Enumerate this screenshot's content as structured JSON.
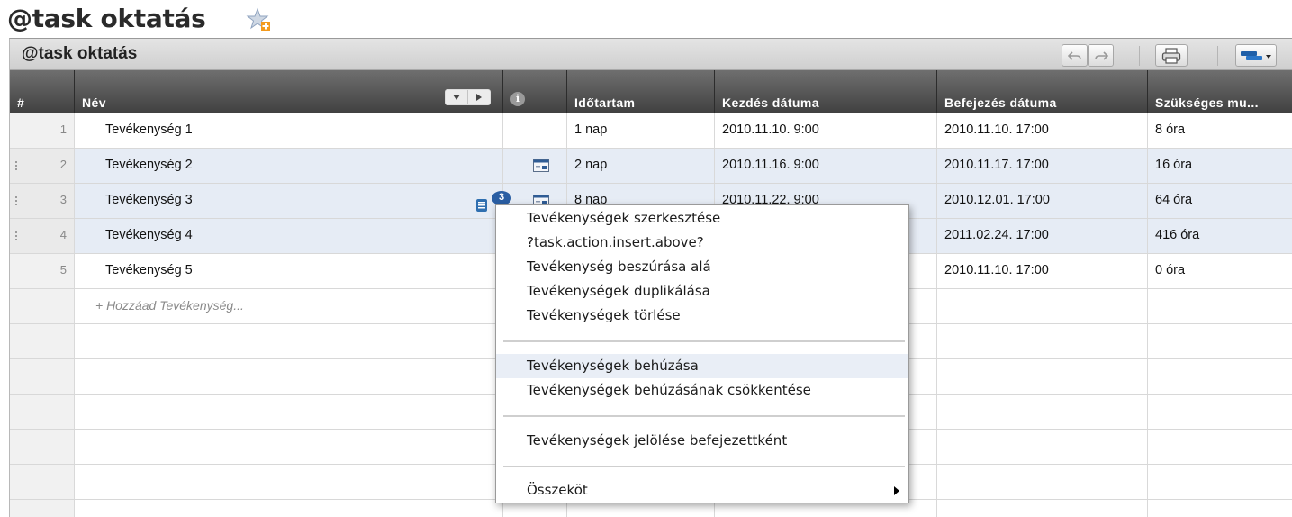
{
  "page": {
    "title": "@task oktatás",
    "favorite_icon": "star-add-icon"
  },
  "panel": {
    "title": "@task oktatás",
    "toolbar": {
      "undo_icon": "undo-icon",
      "redo_icon": "redo-icon",
      "print_icon": "print-icon",
      "gantt_icon": "gantt-view-icon"
    }
  },
  "columns": {
    "num": "#",
    "name": "Név",
    "info": "i",
    "duration": "Időtartam",
    "start": "Kezdés dátuma",
    "end": "Befejezés dátuma",
    "work": "Szükséges mu..."
  },
  "rows": [
    {
      "num": "1",
      "name": "Tevékenység 1",
      "duration": "1 nap",
      "start": "2010.11.10. 9:00",
      "end": "2010.11.10. 17:00",
      "work": "8 óra"
    },
    {
      "num": "2",
      "name": "Tevékenység 2",
      "duration": "2 nap",
      "start": "2010.11.16. 9:00",
      "end": "2010.11.17. 17:00",
      "work": "16 óra"
    },
    {
      "num": "3",
      "name": "Tevékenység 3",
      "duration": "8 nap",
      "start": "2010.11.22. 9:00",
      "end": "2010.12.01. 17:00",
      "work": "64 óra"
    },
    {
      "num": "4",
      "name": "Tevékenység 4",
      "duration": "",
      "start": "",
      "end": "2011.02.24. 17:00",
      "work": "416 óra"
    },
    {
      "num": "5",
      "name": "Tevékenység 5",
      "duration": "",
      "start": "",
      "end": "2010.11.10. 17:00",
      "work": "0 óra"
    }
  ],
  "add_row_label": "+ Hozzáad Tevékenység...",
  "row3_badge": {
    "count": "3",
    "icon": "notes-icon"
  },
  "context_menu": {
    "items": [
      "Tevékenységek szerkesztése",
      "?task.action.insert.above?",
      "Tevékenység beszúrása alá",
      "Tevékenységek duplikálása",
      "Tevékenységek törlése",
      "Tevékenységek behúzása",
      "Tevékenységek behúzásának csökkentése",
      "Tevékenységek jelölése befejezettként",
      "Összeköt"
    ],
    "highlighted": "Tevékenységek behúzása"
  },
  "colors": {
    "header_dark": "#4a4a4a",
    "selected_row": "#e6ecf5",
    "accent_blue": "#2f6fb0"
  }
}
